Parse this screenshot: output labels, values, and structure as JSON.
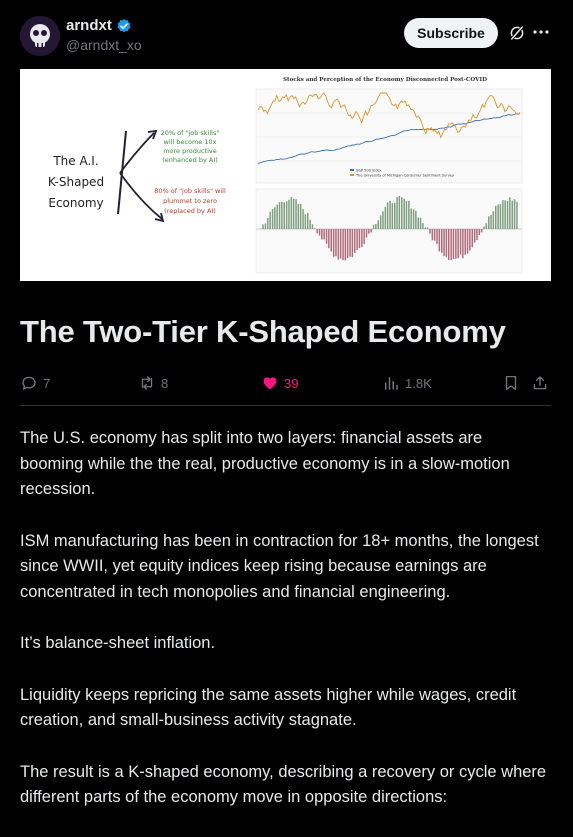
{
  "header": {
    "display_name": "arndxt",
    "handle": "@arndxt_xo",
    "subscribe_label": "Subscribe"
  },
  "cover": {
    "sketch": {
      "title_lines": [
        "The A.I.",
        "K-Shaped",
        "Economy"
      ],
      "upper_note_lines": [
        "20% of \"job skills\"",
        "will become 10x",
        "more productive",
        "(enhanced by AI)"
      ],
      "lower_note_lines": [
        "80% of \"job skills\" will",
        "plummet to zero",
        "(replaced by AI)"
      ]
    },
    "chart": {
      "title": "Stocks and Perception of the Economy Disconnected Post-COVID",
      "legend": [
        "S&P 500 Index",
        "The University of Michigan Consumer Sentiment Survey"
      ]
    }
  },
  "article": {
    "title": "The Two-Tier K-Shaped Economy",
    "paragraphs": [
      "The U.S. economy has split into two layers: financial assets are booming while the the real, productive economy is in a slow-motion recession.",
      "ISM manufacturing has been in contraction for 18+ months, the longest since WWII, yet equity indices keep rising because earnings are concentrated in tech monopolies and financial engineering.",
      "It’s balance-sheet inflation.",
      "Liquidity keeps repricing the same assets higher while wages, credit creation, and small-business activity stagnate.",
      "The result is a K-shaped economy, describing a recovery or cycle where different parts of the economy move in opposite directions:"
    ]
  },
  "actions": {
    "replies": "7",
    "reposts": "8",
    "likes": "39",
    "views": "1.8K"
  },
  "colors": {
    "background": "#000000",
    "text": "#e7e9ea",
    "muted": "#71767b",
    "like_pink": "#f91880",
    "verified_blue": "#1d9bf0"
  }
}
